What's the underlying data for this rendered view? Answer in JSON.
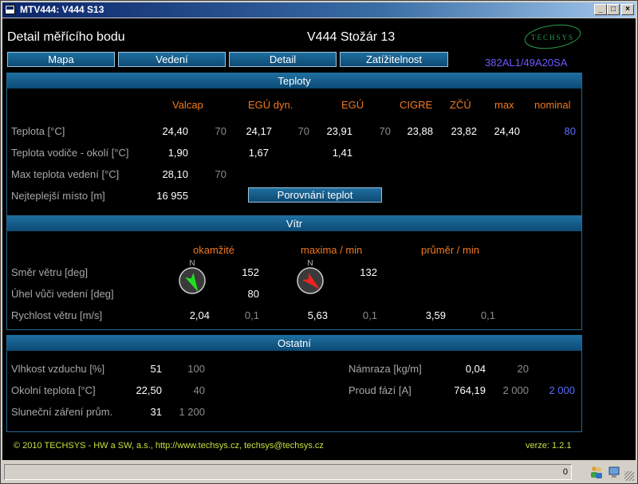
{
  "window": {
    "title": "MTV444: V444 S13"
  },
  "header": {
    "title": "Detail měřícího bodu",
    "line": "V444 Stožár 13",
    "code": "382AL1/49A20SA",
    "logo_text": "TECHSYS"
  },
  "nav": [
    {
      "label": "Mapa"
    },
    {
      "label": "Vedení"
    },
    {
      "label": "Detail"
    },
    {
      "label": "Zatížitelnost"
    }
  ],
  "teploty": {
    "title": "Teploty",
    "columns": [
      "Valcap",
      "EGÚ dyn.",
      "EGÚ",
      "CIGRE",
      "ZČÚ",
      "max",
      "nominal"
    ],
    "rows": [
      {
        "label": "Teplota [°C]",
        "valcap": "24,40",
        "valcap_lim": "70",
        "egu_dyn": "24,17",
        "egu_dyn_lim": "70",
        "egu": "23,91",
        "egu_lim": "70",
        "cigre": "23,88",
        "zcu": "23,82",
        "max": "24,40",
        "nominal": "80"
      },
      {
        "label": "Teplota vodiče - okolí [°C]",
        "valcap": "1,90",
        "egu_dyn": "1,67",
        "egu": "1,41"
      },
      {
        "label": "Max teplota vedení [°C]",
        "valcap": "28,10",
        "valcap_lim": "70"
      },
      {
        "label": "Nejteplejší místo [m]",
        "valcap": "16 955"
      }
    ],
    "compare_button": "Porovnání teplot"
  },
  "vitr": {
    "title": "Vítr",
    "columns": [
      "okamžité",
      "maxima / min",
      "průměr / min"
    ],
    "compass_n": "N",
    "compass_colors": {
      "okamzite": "#22dd22",
      "maxima": "#ee2222"
    },
    "rows": [
      {
        "label": "Směr větru [deg]",
        "okamzite": "152",
        "maxima": "132"
      },
      {
        "label": "Úhel vůči vedení [deg]",
        "okamzite": "80"
      },
      {
        "label": "Rychlost větru [m/s]",
        "okamzite": "2,04",
        "okamzite_lim": "0,1",
        "maxima": "5,63",
        "maxima_lim": "0,1",
        "prumer": "3,59",
        "prumer_lim": "0,1"
      }
    ]
  },
  "ostatni": {
    "title": "Ostatní",
    "left": [
      {
        "label": "Vlhkost vzduchu [%]",
        "value": "51",
        "limit": "100"
      },
      {
        "label": "Okolní teplota [°C]",
        "value": "22,50",
        "limit": "40"
      },
      {
        "label": "Sluneční záření prům.",
        "value": "31",
        "limit": "1 200"
      }
    ],
    "right": [
      {
        "label": "Námraza [kg/m]",
        "value": "0,04",
        "limit": "20"
      },
      {
        "label": "Proud fází [A]",
        "value": "764,19",
        "limit": "2 000",
        "nominal": "2 000"
      }
    ]
  },
  "footer": {
    "copyright": "© 2010 TECHSYS - HW a SW, a.s.,   http://www.techsys.cz,   techsys@techsys.cz",
    "version": "verze:  1.2.1"
  },
  "statusbar": {
    "value": "0"
  }
}
